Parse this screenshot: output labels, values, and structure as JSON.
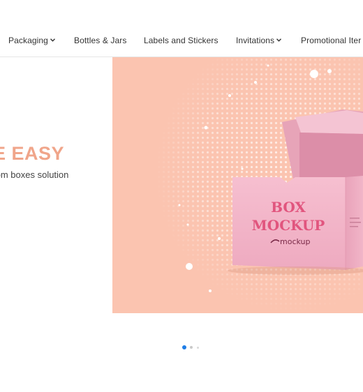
{
  "nav": {
    "items": [
      {
        "label": "Packaging",
        "has_dropdown": true
      },
      {
        "label": "Bottles & Jars",
        "has_dropdown": false
      },
      {
        "label": "Labels and Stickers",
        "has_dropdown": false
      },
      {
        "label": "Invitations",
        "has_dropdown": true
      },
      {
        "label": "Promotional Iter",
        "has_dropdown": false
      }
    ]
  },
  "hero": {
    "headline": "E EASY",
    "subtitle": "tom boxes solution",
    "subtitle_cont": "-"
  },
  "banner": {
    "box_title_line1": "BOX",
    "box_title_line2": "MOCKUP",
    "brand": "mockup",
    "colors": {
      "background": "#fbc4b0",
      "box": "#f2b4c6",
      "box_text": "#e1557e"
    }
  },
  "carousel": {
    "slide_count": 3,
    "active_index": 0
  }
}
